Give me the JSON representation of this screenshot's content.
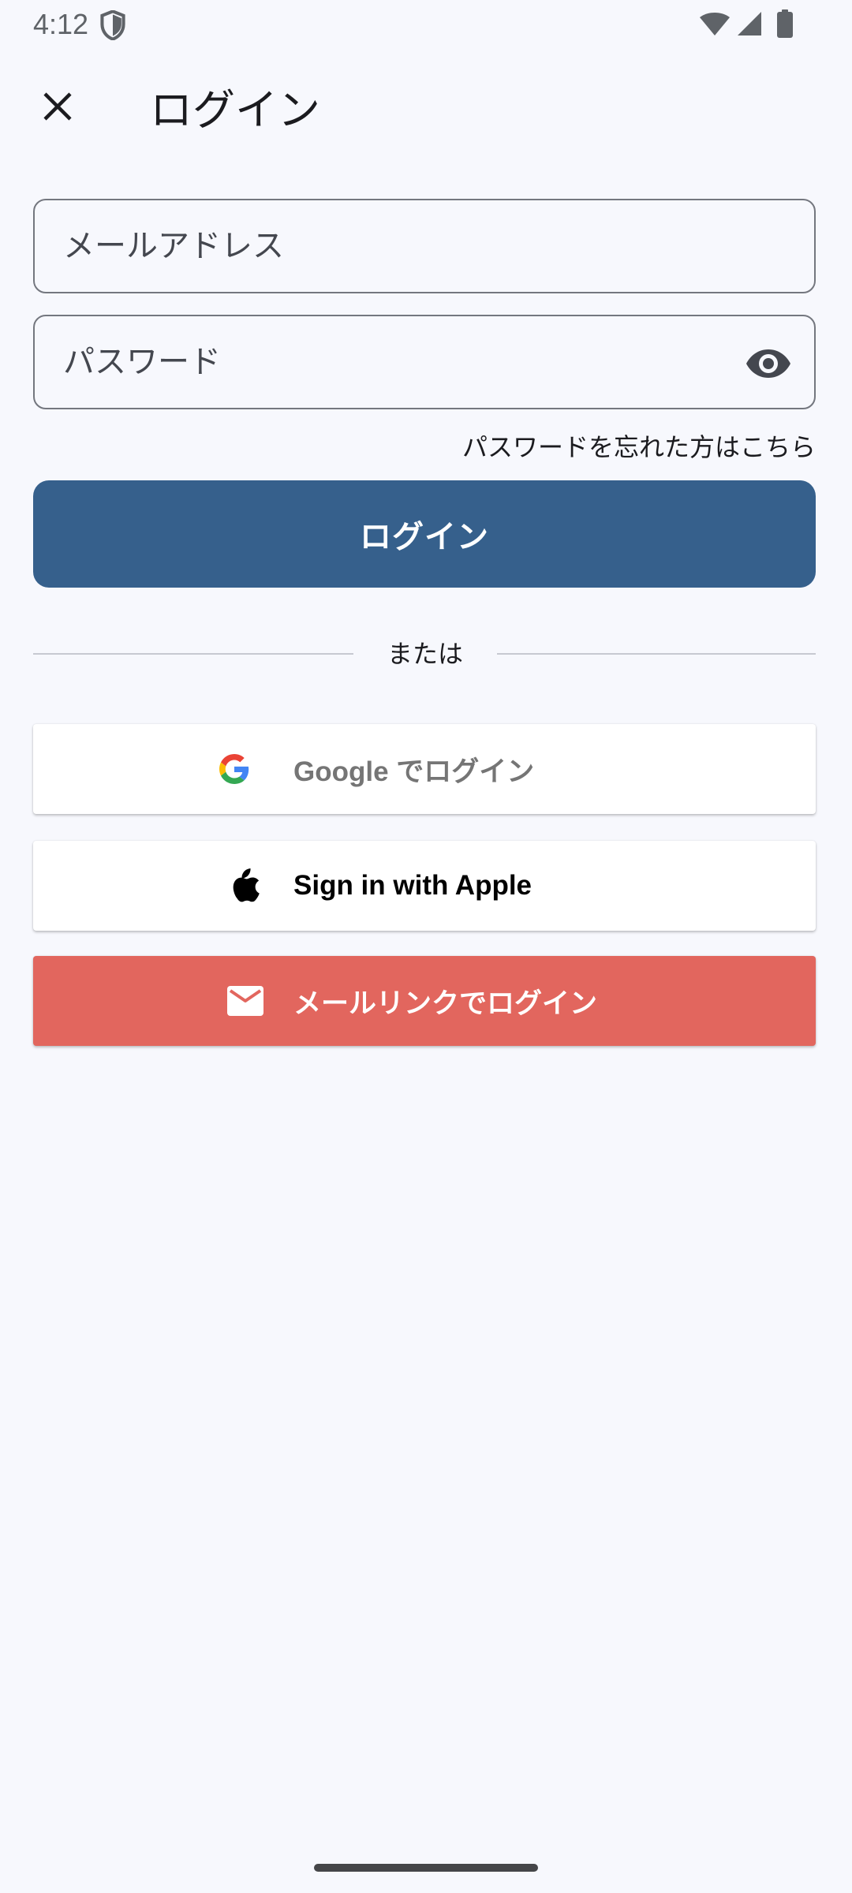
{
  "status_bar": {
    "time": "4:12",
    "icons": [
      "shield-icon",
      "wifi-icon",
      "cellular-signal-icon",
      "battery-icon"
    ]
  },
  "app_bar": {
    "close_icon": "close-icon",
    "title": "ログイン"
  },
  "form": {
    "email": {
      "value": "",
      "placeholder": "メールアドレス"
    },
    "password": {
      "value": "",
      "placeholder": "パスワード",
      "toggle_icon": "eye-icon"
    },
    "forgot_password": "パスワードを忘れた方はこちら",
    "login_button": "ログイン"
  },
  "divider": {
    "label": "または"
  },
  "social": {
    "google": {
      "label": "Google でログイン",
      "icon": "google-icon"
    },
    "apple": {
      "label": "Sign in with Apple",
      "icon": "apple-icon"
    },
    "email_link": {
      "label": "メールリンクでログイン",
      "icon": "mail-icon"
    }
  },
  "colors": {
    "background": "#f7f8fd",
    "primary": "#36608c",
    "outline": "#74777f",
    "mail_button": "#e2665e",
    "google_text": "#757575"
  }
}
